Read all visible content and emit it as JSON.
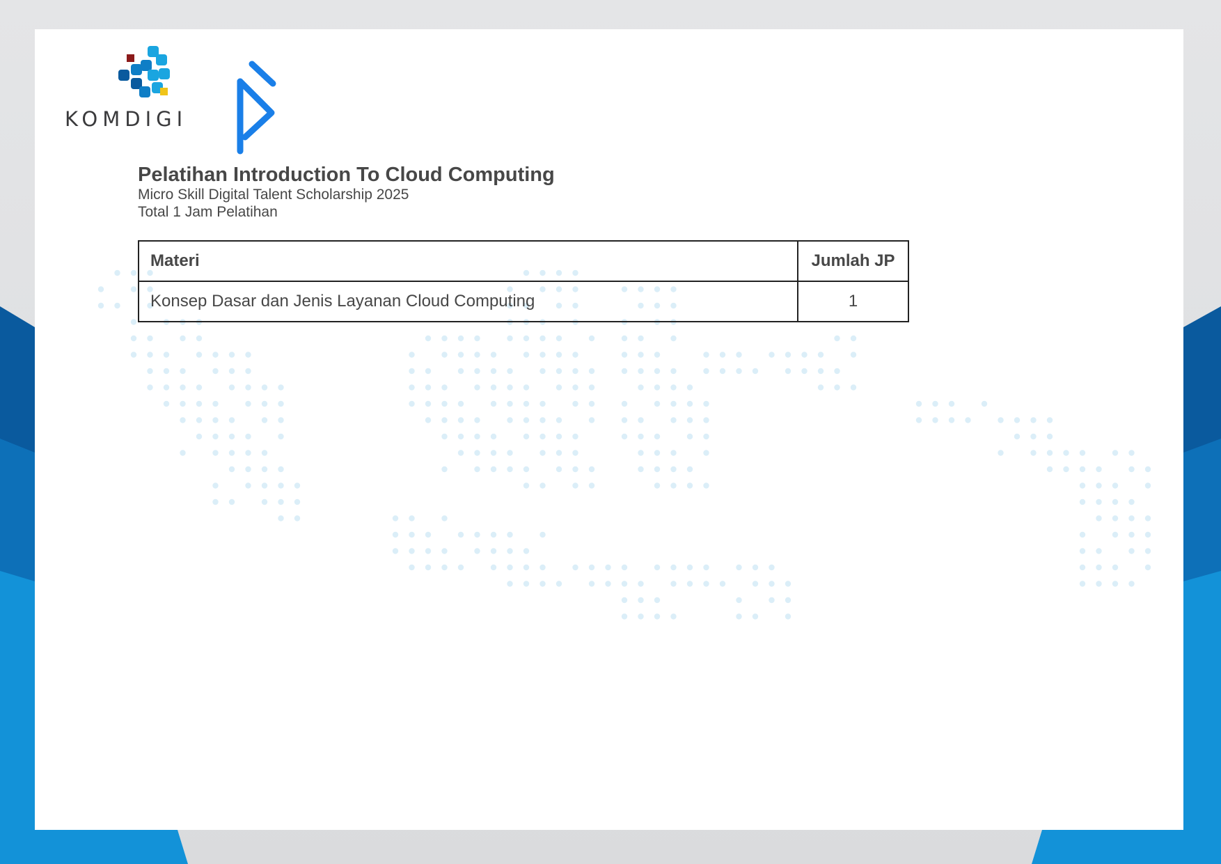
{
  "brand": {
    "org_name": "KOMDIGI",
    "colors": {
      "dark_blue": "#0a5a9e",
      "mid_blue": "#0f7ec6",
      "light_blue": "#1aa5e0",
      "red": "#8b1a1a",
      "yellow": "#f0c419",
      "accent_blue": "#1a7fe8"
    }
  },
  "header": {
    "title": "Pelatihan Introduction To Cloud Computing",
    "subtitle": "Micro Skill Digital Talent Scholarship 2025",
    "total": "Total 1 Jam Pelatihan"
  },
  "table": {
    "headers": {
      "materi": "Materi",
      "jumlah_jp": "Jumlah JP"
    },
    "rows": [
      {
        "materi": "Konsep Dasar dan Jenis Layanan Cloud Computing",
        "jp": "1"
      }
    ]
  }
}
